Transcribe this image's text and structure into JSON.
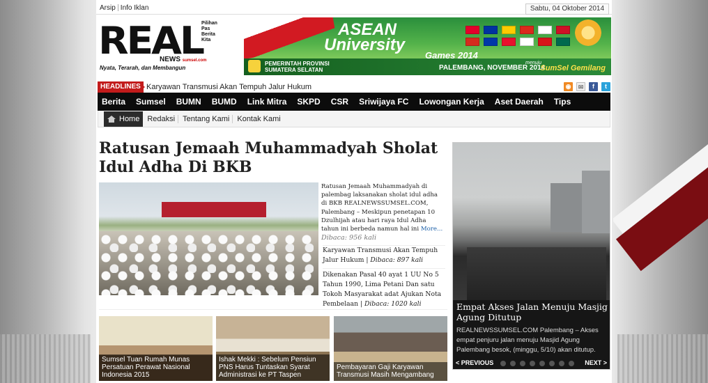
{
  "toplinks": [
    "Arsip",
    "Info Iklan"
  ],
  "date": "Sabtu, 04 Oktober 2014",
  "logo": {
    "word": "REAL",
    "news": "NEWS",
    "domain": "sumsel.com",
    "tagline": "Pilihan Pas Berita Kita",
    "motto": "Nyata, Terarah, dan Membangun"
  },
  "banner": {
    "line1": "ASEAN",
    "line2": "University",
    "line3": "Games 2014",
    "issuer": "PEMERINTAH PROVINSI SUMATERA SELATAN",
    "when": "PALEMBANG, NOVEMBER 2014",
    "menuju": "menuju",
    "slogan": "SumSel Gemilang",
    "flag_colors": [
      "#e4002b",
      "#0033a0",
      "#ffcc00",
      "#da291c",
      "#ffffff",
      "#ce1126",
      "#d52b1e",
      "#0038a8",
      "#e8112d",
      "#ffffff",
      "#d7141a",
      "#006a4e"
    ]
  },
  "headlines": {
    "label": "HEADLINES",
    "text": "Karyawan Transmusi Akan Tempuh Jalur Hukum"
  },
  "social": {
    "rss": "rss-icon",
    "mail": "mail-icon",
    "facebook": "f",
    "twitter": "t"
  },
  "mainnav": [
    "Berita",
    "Sumsel",
    "BUMN",
    "BUMD",
    "Link Mitra",
    "SKPD",
    "CSR",
    "Sriwijaya FC",
    "Lowongan Kerja",
    "Aset Daerah",
    "Tips"
  ],
  "subnav": {
    "home": "Home",
    "items": [
      "Redaksi",
      "Tentang Kami",
      "Kontak Kami"
    ]
  },
  "article": {
    "title": "Ratusan Jemaah Muhammadyah Sholat Idul Adha Di BKB",
    "summary": "Ratusan Jemaah Muhammadyah di palembag laksanakan sholat idul adha di BKB REALNEWSSUMSEL.COM, Palembang – Meskipun penetapan 10 Dzulhijah atau hari raya Idul Adha tahun ini berbeda namun hal ini",
    "more": "More...",
    "reads": "Dibaca: 956 kali"
  },
  "related": [
    {
      "text": "Karyawan Transmusi Akan Tempuh Jalur Hukum",
      "reads": "Dibaca: 897 kali"
    },
    {
      "text": "Dikenakan Pasal 40 ayat 1 UU No 5 Tahun 1990, Lima Petani Dan satu Tokoh Masyarakat adat Ajukan Nota Pembelaan",
      "reads": "Dibaca: 1020 kali"
    }
  ],
  "thumbs": [
    "Sumsel Tuan Rumah Munas Persatuan Perawat Nasional Indonesia 2015",
    "Ishak Mekki : Sebelum Pensiun PNS Harus Tuntaskan Syarat Administrasi ke PT Taspen",
    "Pembayaran Gaji Karyawan Transmusi Masih Mengambang"
  ],
  "slider": {
    "title": "Empat Akses Jalan Menuju Masjig Agung Ditutup",
    "desc": "REALNEWSSUMSEL.COM Palembang – Akses empat penjuru jalan menuju Masjid Agung Palembang besok, (minggu, 5/10) akan ditutup.",
    "prev": "< PREVIOUS",
    "next": "NEXT >",
    "dot_count": 8
  }
}
